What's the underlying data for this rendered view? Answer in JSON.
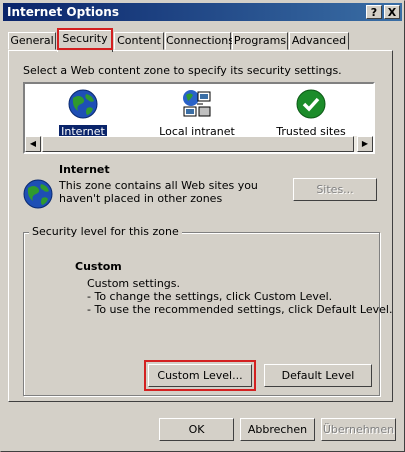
{
  "window": {
    "title": "Internet Options",
    "help_btn": "?",
    "close_btn": "X"
  },
  "tabs": [
    {
      "label": "General"
    },
    {
      "label": "Security"
    },
    {
      "label": "Content"
    },
    {
      "label": "Connections"
    },
    {
      "label": "Programs"
    },
    {
      "label": "Advanced"
    }
  ],
  "security": {
    "instruction": "Select a Web content zone to specify its security settings.",
    "zones": [
      {
        "label": "Internet",
        "icon": "globe-icon"
      },
      {
        "label": "Local intranet",
        "icon": "network-computers-icon"
      },
      {
        "label": "Trusted sites",
        "icon": "green-check-icon"
      }
    ],
    "zone_title": "Internet",
    "zone_description": "This zone contains all Web sites you haven't placed in other zones",
    "sites_button": "Sites...",
    "group_label": "Security level for this zone",
    "level_title": "Custom",
    "level_lines": [
      "Custom settings.",
      "- To change the settings, click Custom Level.",
      "- To use the recommended settings, click Default Level."
    ],
    "custom_level_button": "Custom Level...",
    "default_level_button": "Default Level"
  },
  "footer": {
    "ok": "OK",
    "cancel": "Abbrechen",
    "apply": "Übernehmen"
  }
}
